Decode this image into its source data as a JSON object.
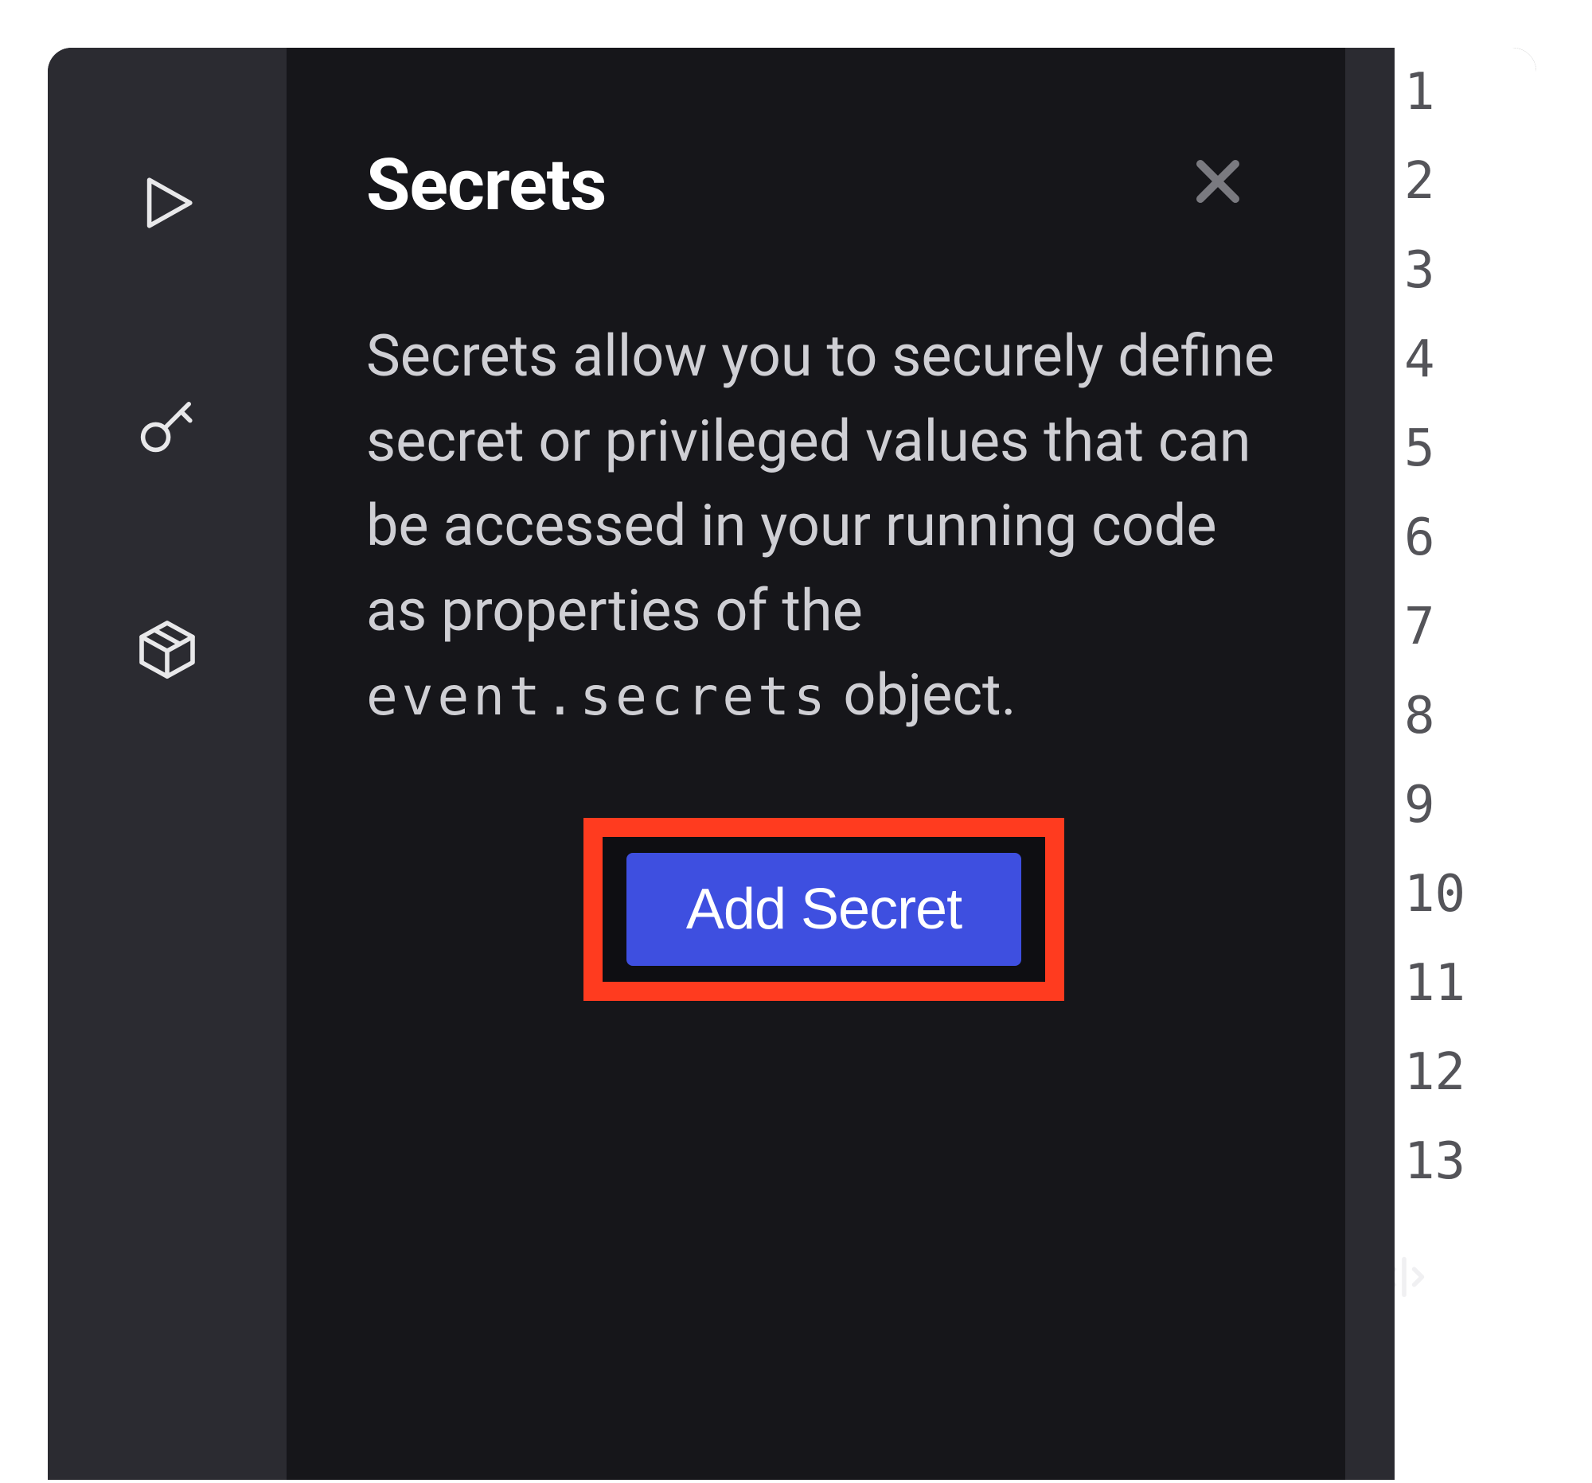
{
  "rail": {
    "items": [
      {
        "name": "play-icon"
      },
      {
        "name": "key-icon"
      },
      {
        "name": "package-icon"
      }
    ]
  },
  "panel": {
    "title": "Secrets",
    "desc_part1": "Secrets allow you to securely define secret or privileged values that can be accessed in your running code as properties of the ",
    "desc_code": "event.secrets",
    "desc_part2": " object.",
    "button_label": "Add Secret"
  },
  "editor": {
    "line_numbers": [
      "1",
      "2",
      "3",
      "4",
      "5",
      "6",
      "7",
      "8",
      "9",
      "10",
      "11",
      "12",
      "13"
    ]
  },
  "colors": {
    "accent": "#3e4fe0",
    "highlight": "#ff3b1f",
    "panel_bg": "#16161a",
    "rail_bg": "#2b2b31"
  }
}
